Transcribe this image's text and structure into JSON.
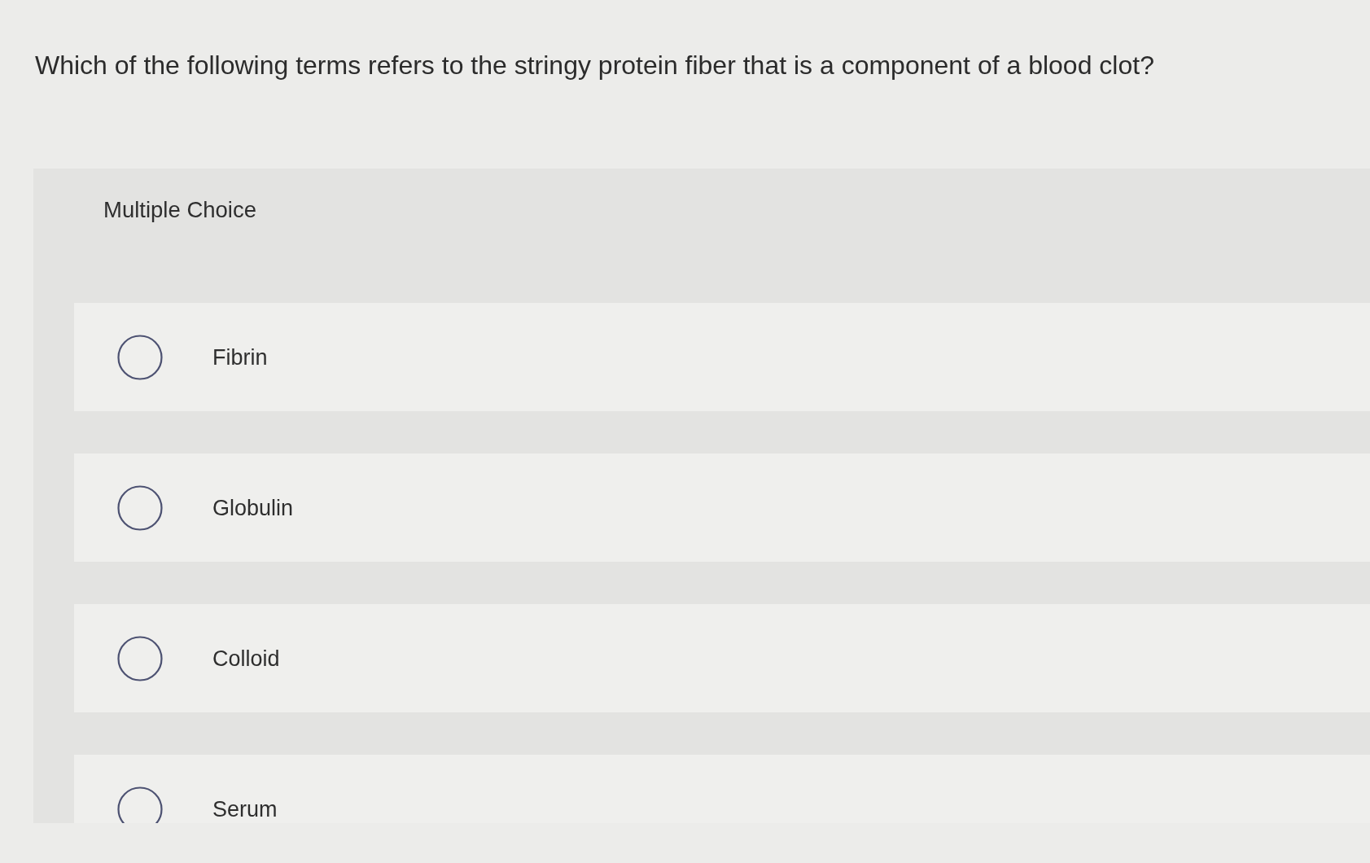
{
  "question": "Which of the following terms refers to the stringy protein fiber that is a component of a blood clot?",
  "answer_panel": {
    "label": "Multiple Choice",
    "options": [
      {
        "label": "Fibrin",
        "selected": false
      },
      {
        "label": "Globulin",
        "selected": false
      },
      {
        "label": "Colloid",
        "selected": false
      },
      {
        "label": "Serum",
        "selected": false
      }
    ]
  }
}
